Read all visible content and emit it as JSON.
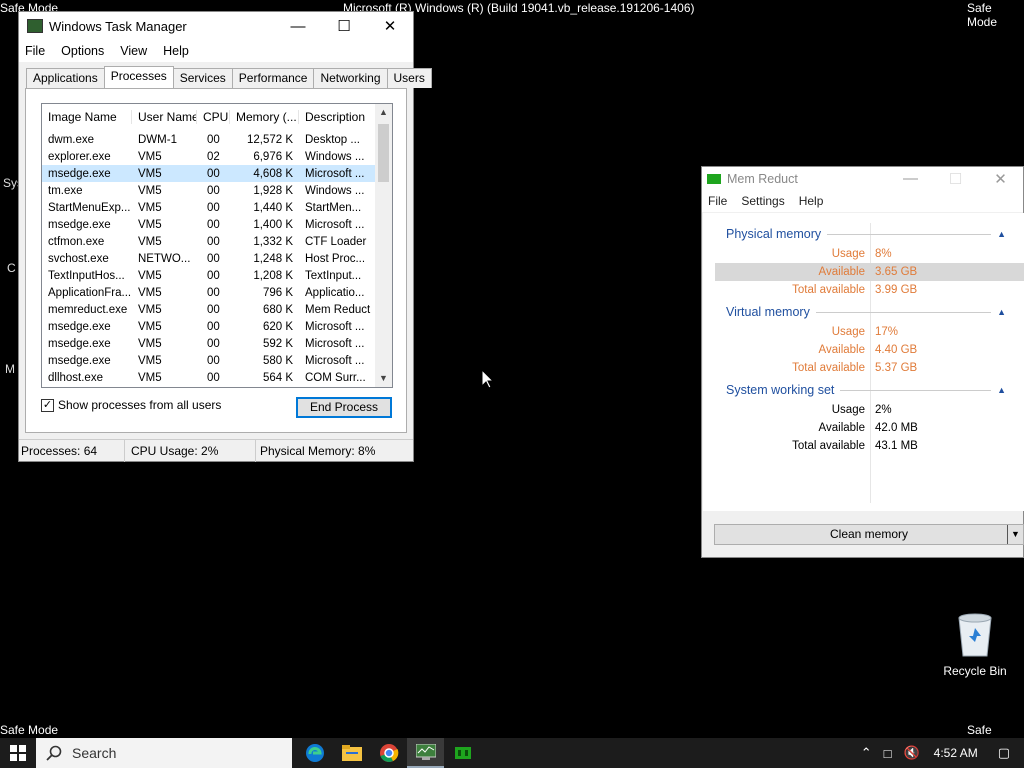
{
  "desktop": {
    "top_left_text": "Safe Mode",
    "top_center_text": "Microsoft (R) Windows (R) (Build 19041.vb_release.191206-1406)",
    "top_right_text": "Safe Mode",
    "bottom_left_text": "Safe Mode",
    "bottom_right_text": "Safe Mode",
    "recycle_bin_label": "Recycle Bin",
    "left_fragments": [
      "Sys",
      "C",
      "M"
    ]
  },
  "task_manager": {
    "title": "Windows Task Manager",
    "menu": [
      "File",
      "Options",
      "View",
      "Help"
    ],
    "tabs": [
      "Applications",
      "Processes",
      "Services",
      "Performance",
      "Networking",
      "Users"
    ],
    "active_tab": "Processes",
    "columns": [
      "Image Name",
      "User Name",
      "CPU",
      "Memory (...",
      "Description"
    ],
    "rows": [
      [
        "dwm.exe",
        "DWM-1",
        "00",
        "12,572 K",
        "Desktop ..."
      ],
      [
        "explorer.exe",
        "VM5",
        "02",
        "6,976 K",
        "Windows ..."
      ],
      [
        "msedge.exe",
        "VM5",
        "00",
        "4,608 K",
        "Microsoft ..."
      ],
      [
        "tm.exe",
        "VM5",
        "00",
        "1,928 K",
        "Windows ..."
      ],
      [
        "StartMenuExp...",
        "VM5",
        "00",
        "1,440 K",
        "StartMen..."
      ],
      [
        "msedge.exe",
        "VM5",
        "00",
        "1,400 K",
        "Microsoft ..."
      ],
      [
        "ctfmon.exe",
        "VM5",
        "00",
        "1,332 K",
        "CTF Loader"
      ],
      [
        "svchost.exe",
        "NETWO...",
        "00",
        "1,248 K",
        "Host Proc..."
      ],
      [
        "TextInputHos...",
        "VM5",
        "00",
        "1,208 K",
        "TextInput..."
      ],
      [
        "ApplicationFra...",
        "VM5",
        "00",
        "796 K",
        "Applicatio..."
      ],
      [
        "memreduct.exe",
        "VM5",
        "00",
        "680 K",
        "Mem Reduct"
      ],
      [
        "msedge.exe",
        "VM5",
        "00",
        "620 K",
        "Microsoft ..."
      ],
      [
        "msedge.exe",
        "VM5",
        "00",
        "592 K",
        "Microsoft ..."
      ],
      [
        "msedge.exe",
        "VM5",
        "00",
        "580 K",
        "Microsoft ..."
      ],
      [
        "dllhost.exe",
        "VM5",
        "00",
        "564 K",
        "COM Surr..."
      ]
    ],
    "selected_row": 2,
    "show_all_label": "Show processes from all users",
    "end_process_label": "End Process",
    "status": [
      "Processes: 64",
      "CPU Usage: 2%",
      "Physical Memory: 8%"
    ]
  },
  "mem_reduct": {
    "title": "Mem Reduct",
    "menu": [
      "File",
      "Settings",
      "Help"
    ],
    "groups": [
      {
        "name": "Physical memory",
        "rows": [
          [
            "Usage",
            "8%"
          ],
          [
            "Available",
            "3.65 GB"
          ],
          [
            "Total available",
            "3.99 GB"
          ]
        ]
      },
      {
        "name": "Virtual memory",
        "rows": [
          [
            "Usage",
            "17%"
          ],
          [
            "Available",
            "4.40 GB"
          ],
          [
            "Total available",
            "5.37 GB"
          ]
        ]
      },
      {
        "name": "System working set",
        "rows": [
          [
            "Usage",
            "2%"
          ],
          [
            "Available",
            "42.0 MB"
          ],
          [
            "Total available",
            "43.1 MB"
          ]
        ]
      }
    ],
    "clean_label": "Clean memory",
    "accent_color": "#e07b39"
  },
  "taskbar": {
    "search_placeholder": "Search",
    "time": "4:52 AM"
  }
}
